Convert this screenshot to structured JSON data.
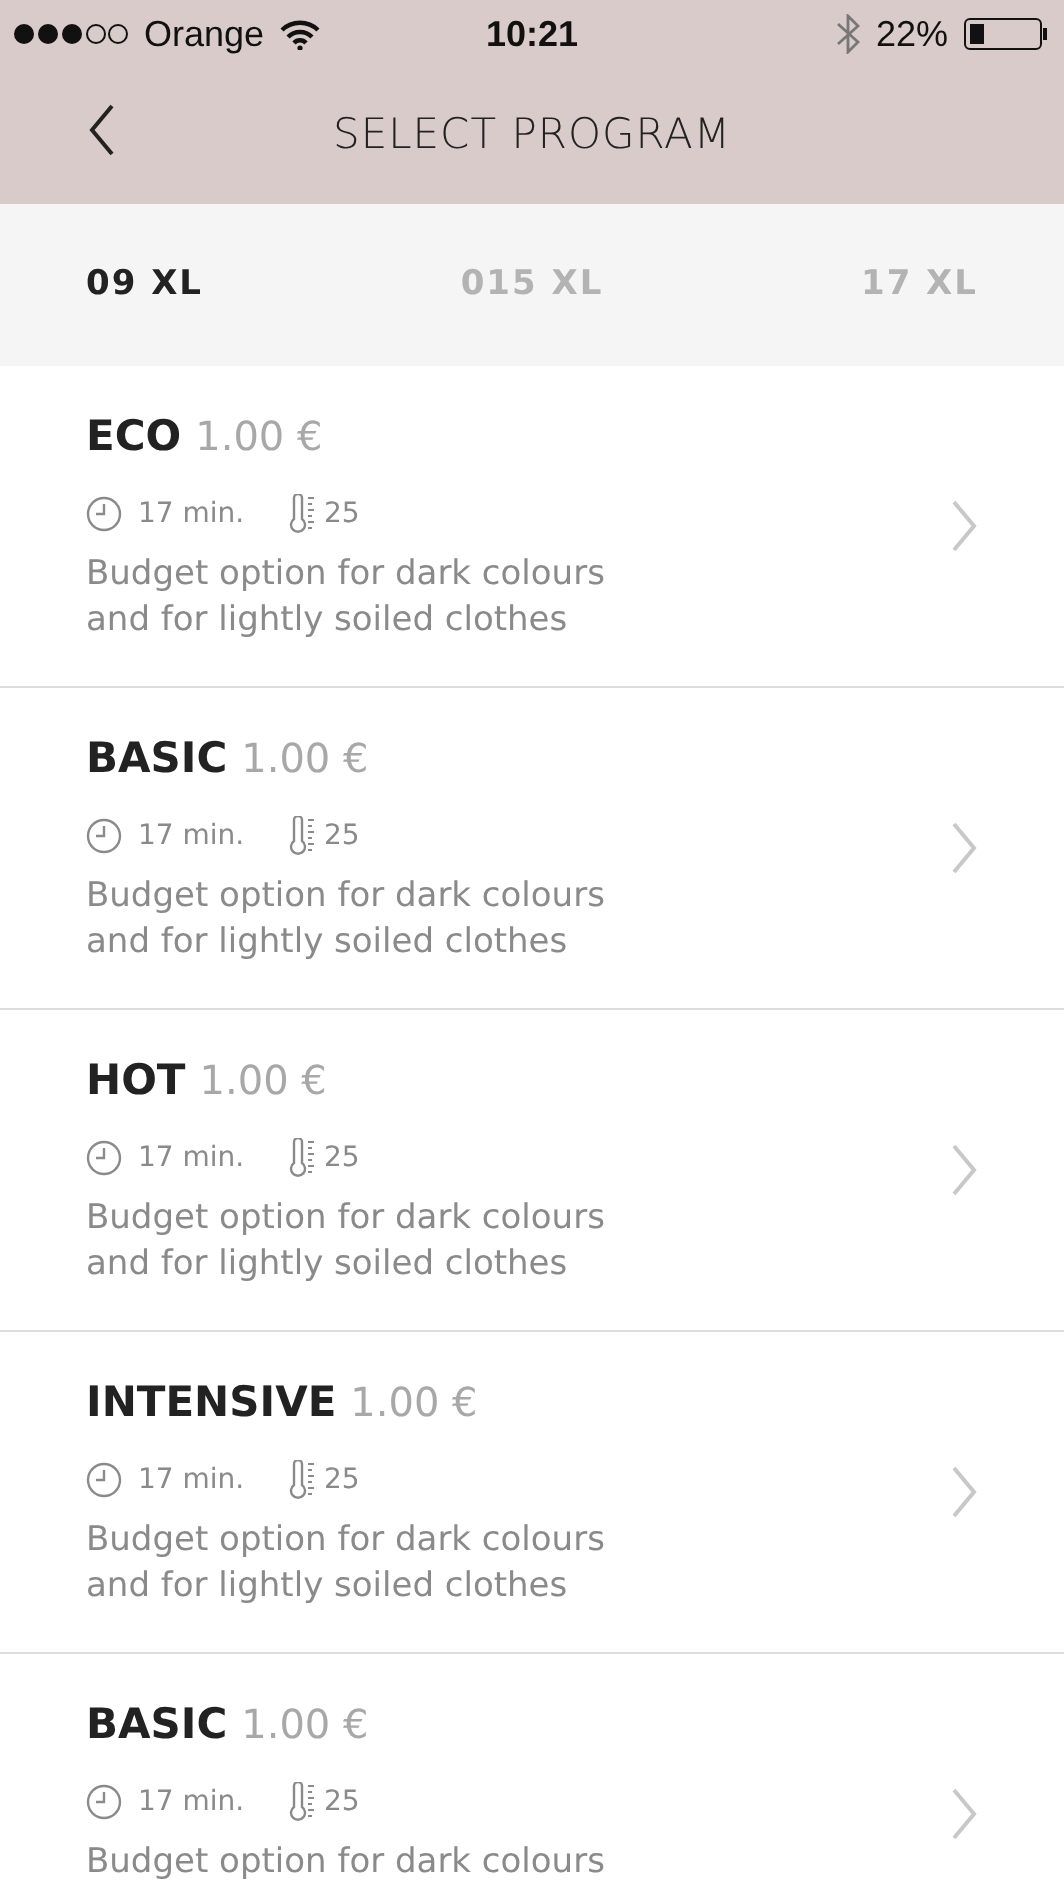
{
  "status_bar": {
    "carrier": "Orange",
    "time": "10:21",
    "battery": "22%"
  },
  "nav": {
    "title": "SELECT PROGRAM"
  },
  "tabs": [
    {
      "label": "09 XL",
      "selected": true
    },
    {
      "label": "015 XL",
      "selected": false
    },
    {
      "label": "17 XL",
      "selected": false
    }
  ],
  "programs": [
    {
      "name": "ECO",
      "price": "1.00 €",
      "duration": "17 min.",
      "temperature": "25",
      "description": [
        "Budget option for dark colours",
        "and for lightly soiled clothes"
      ]
    },
    {
      "name": "BASIC",
      "price": "1.00 €",
      "duration": "17 min.",
      "temperature": "25",
      "description": [
        "Budget option for dark colours",
        "and for lightly soiled clothes"
      ]
    },
    {
      "name": "HOT",
      "price": "1.00 €",
      "duration": "17 min.",
      "temperature": "25",
      "description": [
        "Budget option for dark colours",
        "and for lightly soiled clothes"
      ]
    },
    {
      "name": "INTENSIVE",
      "price": "1.00 €",
      "duration": "17 min.",
      "temperature": "25",
      "description": [
        "Budget option for dark colours",
        "and for lightly soiled clothes"
      ]
    },
    {
      "name": "BASIC",
      "price": "1.00 €",
      "duration": "17 min.",
      "temperature": "25",
      "description": [
        "Budget option for dark colours"
      ]
    }
  ]
}
